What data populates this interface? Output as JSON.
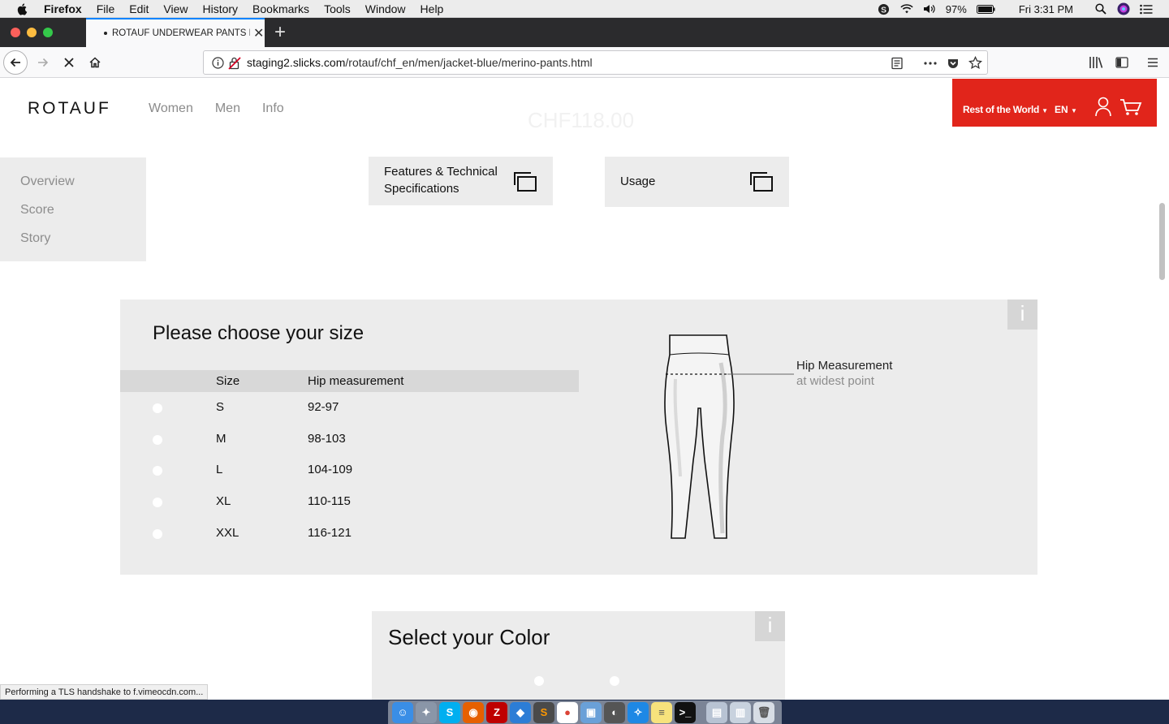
{
  "menubar": {
    "app": "Firefox",
    "items": [
      "File",
      "Edit",
      "View",
      "History",
      "Bookmarks",
      "Tools",
      "Window",
      "Help"
    ],
    "battery": "97%",
    "clock": "Fri 3:31 PM"
  },
  "browser": {
    "tab_title": "ROTAUF UNDERWEAR PANTS M",
    "url_host": "staging2.slicks.com",
    "url_path": "/rotauf/chf_en/men/jacket-blue/merino-pants.html",
    "status": "Performing a TLS handshake to f.vimeocdn.com..."
  },
  "site": {
    "logo": "ROTAUF",
    "nav": [
      "Women",
      "Men",
      "Info"
    ],
    "ghost_price": "CHF118.00",
    "region": "Rest of the World",
    "language": "EN",
    "accent": "#e1251b"
  },
  "subnav": [
    "Overview",
    "Score",
    "Story"
  ],
  "tiles": {
    "features": [
      "Features & Technical",
      "Specifications"
    ],
    "usage": "Usage"
  },
  "size_panel": {
    "title": "Please choose your size",
    "info": "i",
    "col_size": "Size",
    "col_hip": "Hip measurement",
    "rows": [
      {
        "size": "S",
        "hip": "92-97"
      },
      {
        "size": "M",
        "hip": "98-103"
      },
      {
        "size": "L",
        "hip": "104-109"
      },
      {
        "size": "XL",
        "hip": "110-115"
      },
      {
        "size": "XXL",
        "hip": "116-121"
      }
    ],
    "hip_label": "Hip Measurement",
    "hip_sub": "at widest point"
  },
  "color_panel": {
    "title": "Select your Color",
    "info": "i"
  }
}
